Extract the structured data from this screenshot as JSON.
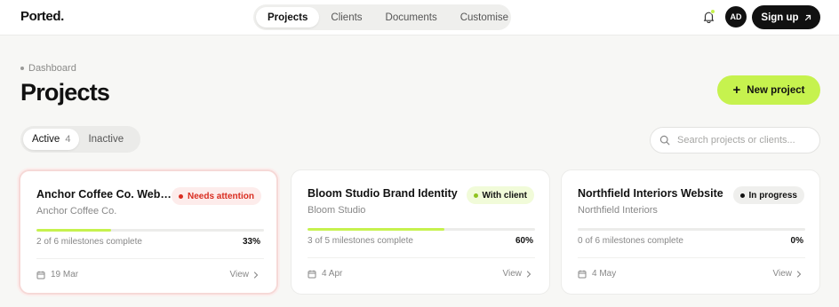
{
  "header": {
    "logo": "Ported.",
    "nav": [
      "Projects",
      "Clients",
      "Documents",
      "Customise"
    ],
    "avatar_initials": "AD",
    "signup_label": "Sign up",
    "notification_dot_color": "#c6f24e"
  },
  "page": {
    "breadcrumb": "Dashboard",
    "title": "Projects",
    "new_project_label": "New project"
  },
  "filters": {
    "active_label": "Active",
    "active_count": "4",
    "inactive_label": "Inactive",
    "search_placeholder": "Search projects or clients..."
  },
  "projects": [
    {
      "title": "Anchor Coffee Co. Website",
      "client": "Anchor Coffee Co.",
      "status": "Needs attention",
      "status_color": "#d92d20",
      "status_bg": "#fdeceb",
      "milestones": "2 of 6 milestones complete",
      "progress_percent": 33,
      "percent_label": "33%",
      "date": "19 Mar",
      "view_label": "View"
    },
    {
      "title": "Bloom Studio Brand Identity",
      "client": "Bloom Studio",
      "status": "With client",
      "status_color": "#8fc31f",
      "status_bg": "#f1fbd9",
      "milestones": "3 of 5 milestones complete",
      "progress_percent": 60,
      "percent_label": "60%",
      "date": "4 Apr",
      "view_label": "View"
    },
    {
      "title": "Northfield Interiors Website",
      "client": "Northfield Interiors",
      "status": "In progress",
      "status_color": "#111111",
      "status_bg": "#efefed",
      "milestones": "0 of 6 milestones complete",
      "progress_percent": 0,
      "percent_label": "0%",
      "date": "4 May",
      "view_label": "View"
    }
  ]
}
